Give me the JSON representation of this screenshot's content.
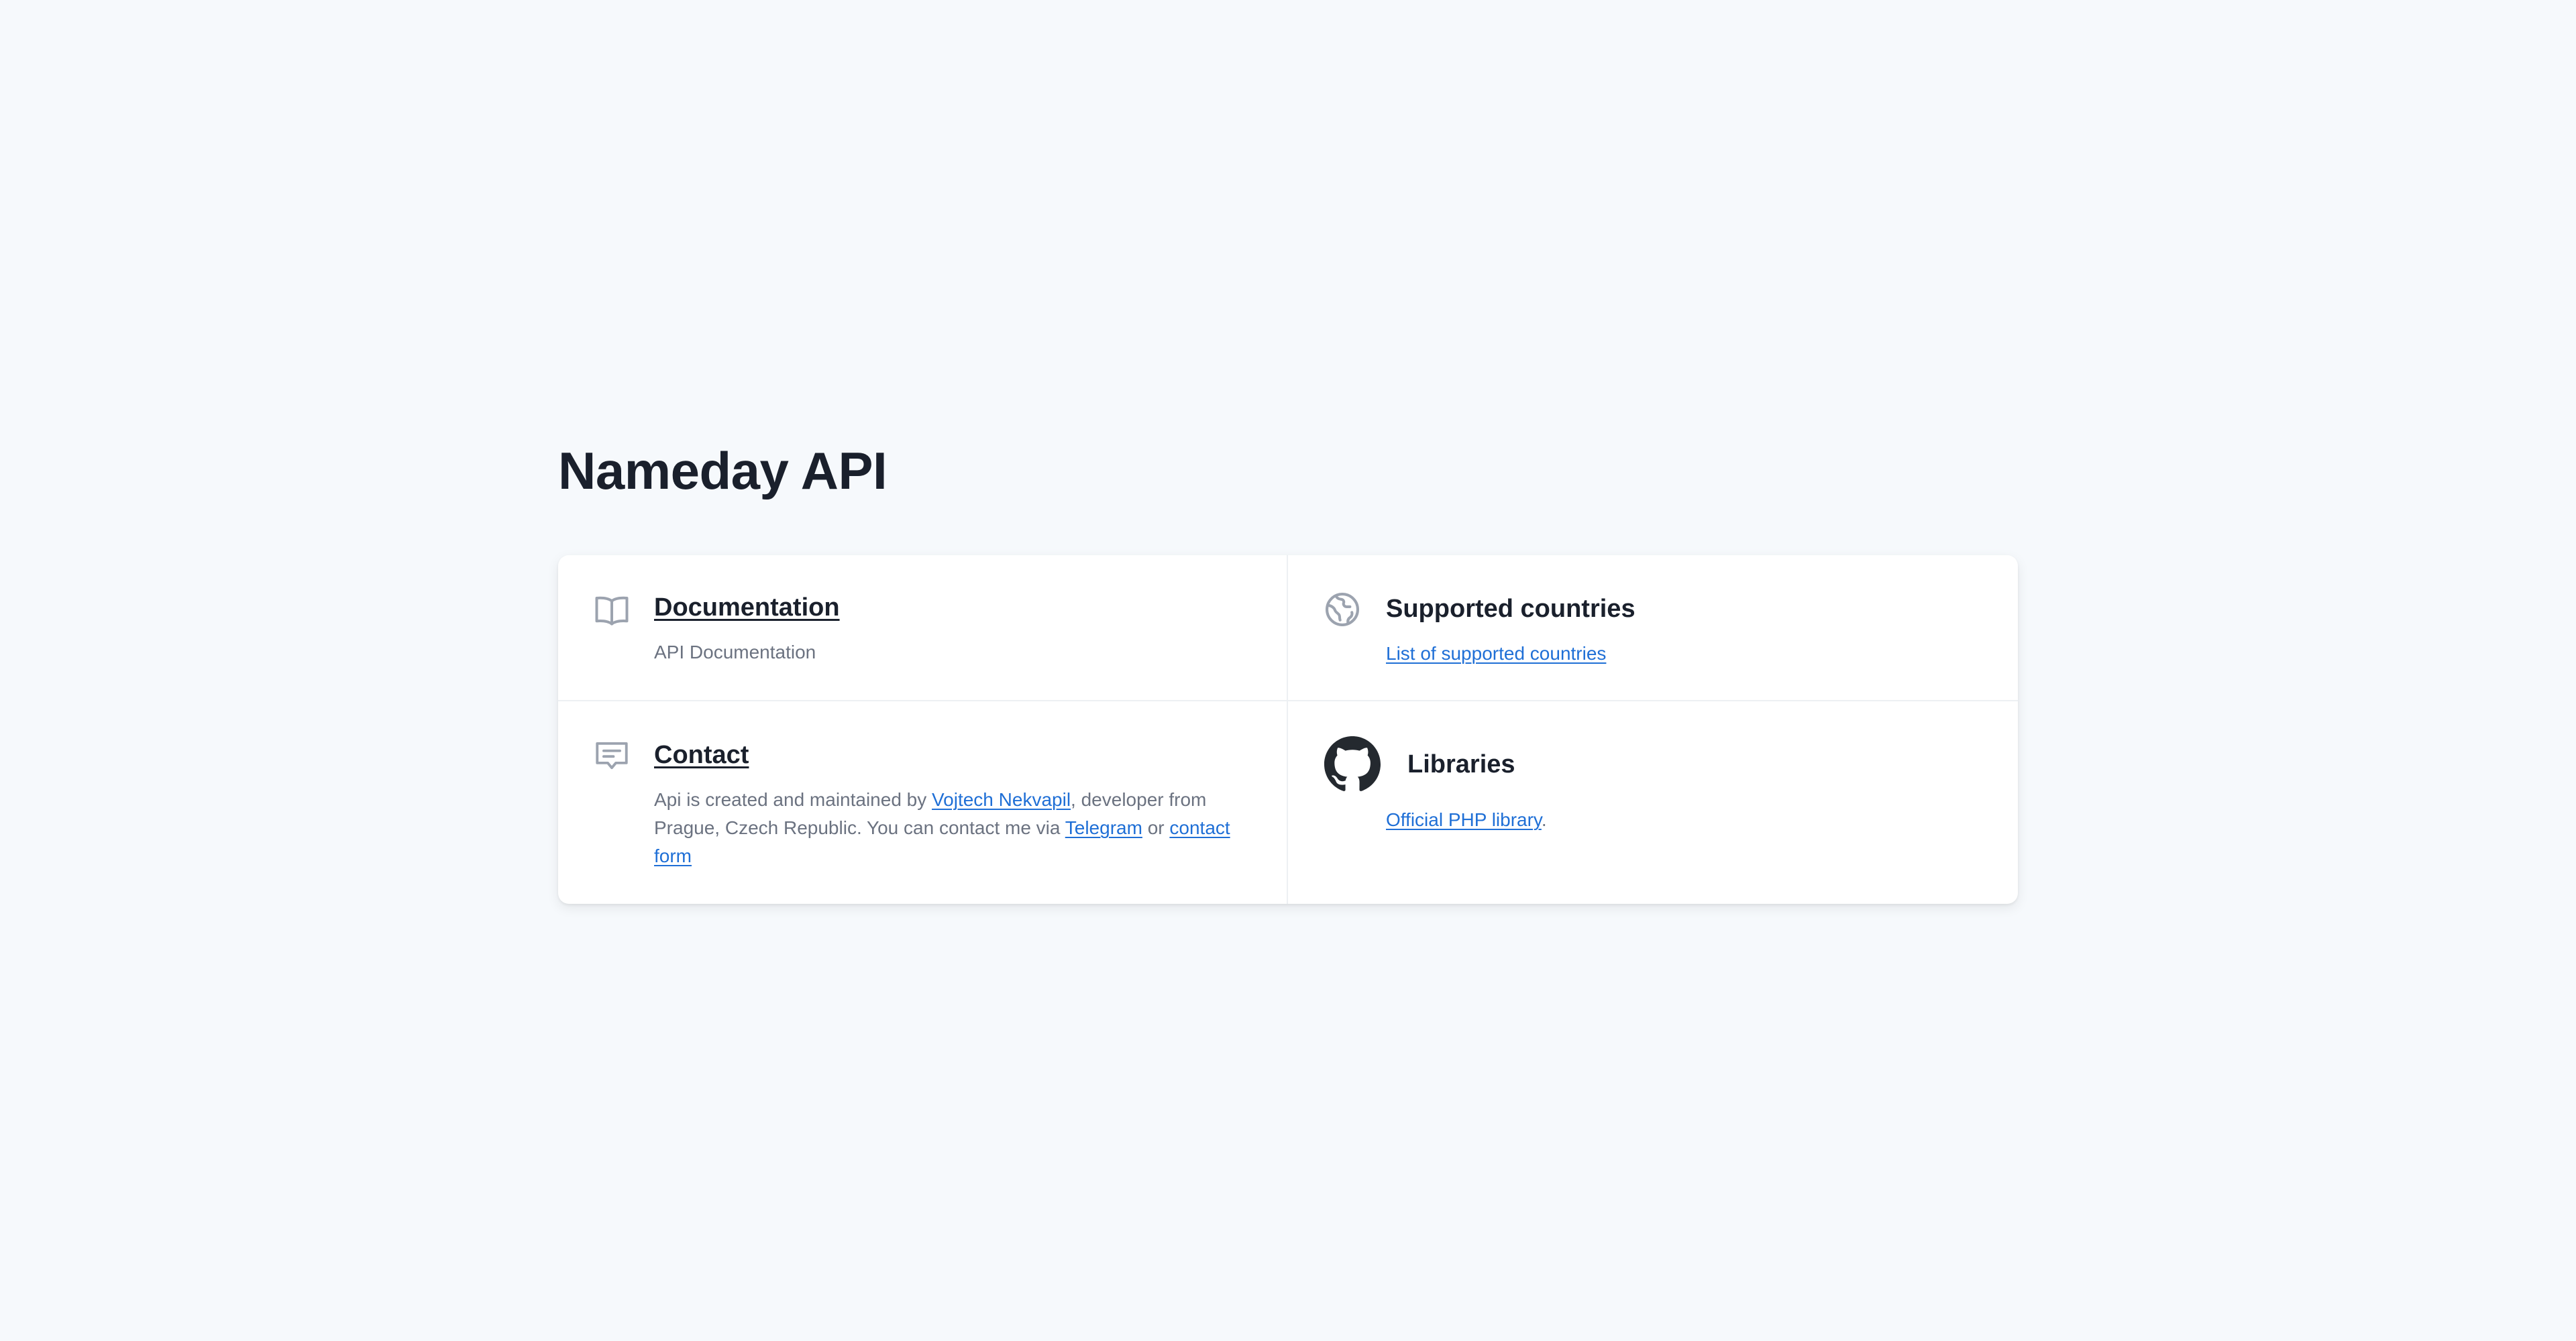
{
  "page": {
    "title": "Nameday API"
  },
  "documentation": {
    "title": "Documentation",
    "description": "API Documentation"
  },
  "supported_countries": {
    "title": "Supported countries",
    "link_label": "List of supported countries"
  },
  "contact": {
    "title": "Contact",
    "text_1": "Api is created and maintained by ",
    "author_link": "Vojtech Nekvapil",
    "text_2": ", developer from Prague, Czech Republic. You can contact me via ",
    "telegram_link": "Telegram",
    "text_3": " or ",
    "contact_form_link": "contact form"
  },
  "libraries": {
    "title": "Libraries",
    "link_label": "Official PHP library",
    "suffix": "."
  },
  "icons": {
    "documentation": "book-open-icon",
    "supported_countries": "globe-icon",
    "contact": "chat-icon",
    "libraries": "github-icon"
  },
  "colors": {
    "background": "#f6f9fc",
    "link": "#1f6fd6",
    "icon": "#9ca3af",
    "heading": "#1a202c",
    "muted_text": "#6b7280"
  }
}
